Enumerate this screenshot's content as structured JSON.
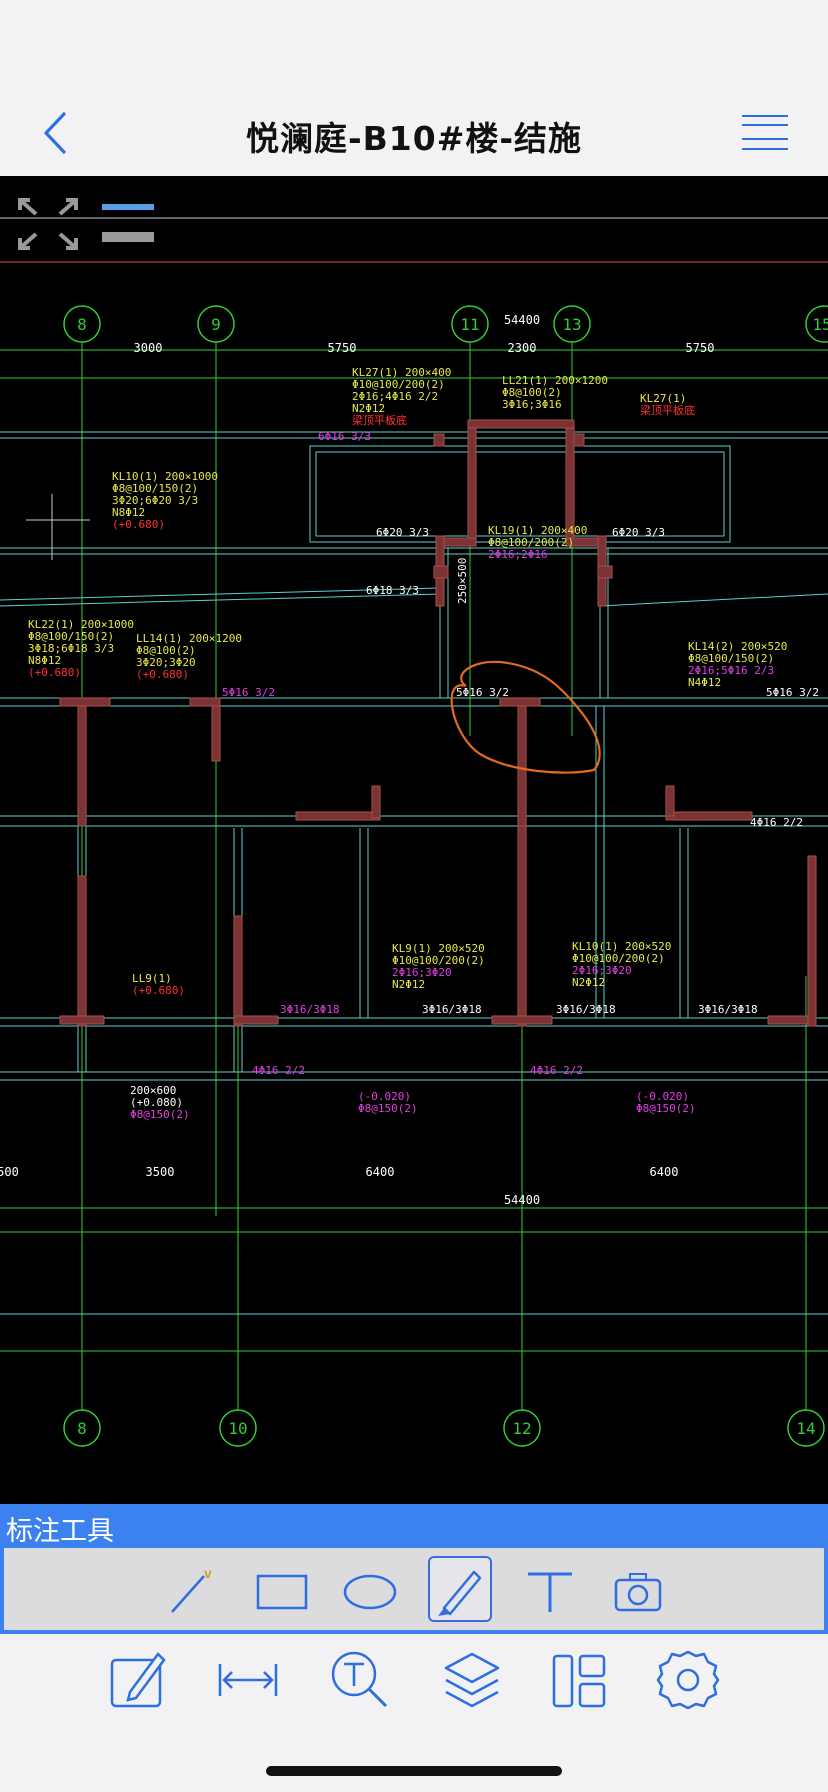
{
  "nav": {
    "title": "悦澜庭-B10#楼-结施",
    "back_icon": "chevron-left-icon",
    "menu_icon": "menu-icon"
  },
  "drawing": {
    "top_axes": [
      "8",
      "9",
      "11",
      "13",
      "15"
    ],
    "bottom_axes": [
      "8",
      "10",
      "12",
      "14"
    ],
    "top_total": "54400",
    "top_spans": [
      "3000",
      "5750",
      "2300",
      "5750"
    ],
    "bottom_total": "54400",
    "bottom_spans": [
      "500",
      "3500",
      "6400",
      "6400"
    ],
    "beam_notes": [
      "KL27(1) 200×400",
      "Φ10@100/200(2)",
      "2Φ16;4Φ16 2/2",
      "N2Φ12",
      "梁顶平板底",
      "LL21(1) 200×1200",
      "Φ8@100(2)",
      "3Φ16;3Φ16",
      "KL27(1)",
      "梁顶平板底",
      "KL10(1) 200×1000",
      "Φ8@100/150(2)",
      "3Φ20;6Φ20 3/3",
      "N8Φ12",
      "(+0.680)",
      "KL22(1) 200×1000",
      "Φ8@100/150(2)",
      "3Φ18;6Φ18 3/3",
      "N8Φ12",
      "(+0.680)",
      "LL14(1) 200×1200",
      "Φ8@100(2)",
      "3Φ20;3Φ20",
      "(+0.680)",
      "KL19(1) 200×400",
      "Φ8@100/200(2)",
      "2Φ16;2Φ16",
      "KL14(2) 200×520",
      "Φ8@100/150(2)",
      "2Φ16;5Φ16 2/3",
      "N4Φ12",
      "KL9(1) 200×520",
      "Φ10@100/200(2)",
      "2Φ16;3Φ20",
      "N2Φ12",
      "KL10(1) 200×520",
      "Φ10@100/200(2)",
      "2Φ16;3Φ20",
      "N2Φ12",
      "LL9(1)",
      "(+0.680)",
      "200×600",
      "(+0.080)",
      "Φ8@150(2)",
      "(-0.020)",
      "Φ8@150(2)",
      "(-0.020)",
      "Φ8@150(2)"
    ],
    "rebar_labels": [
      "6Φ16 3/3",
      "6Φ20 3/3",
      "6Φ20 3/3",
      "6Φ18 3/3",
      "5Φ16 3/2",
      "5Φ16 3/2",
      "5Φ16 3/2",
      "4Φ16 2/2",
      "3Φ16/3Φ18",
      "3Φ16/3Φ18",
      "3Φ16/3Φ18",
      "3Φ16/3Φ18",
      "4Φ16 2/2",
      "4Φ16 2/2",
      "250×500"
    ],
    "colors": {
      "axis": "#33cc33",
      "wall": "#9a3b3b",
      "beam": "#5cd0d0",
      "note_yellow": "#e8e84a",
      "note_magenta": "#e040e0",
      "note_red": "#ff3030",
      "markup": "#e06a20"
    }
  },
  "annotation_tools": {
    "title": "标注工具",
    "items": [
      {
        "icon": "line-icon"
      },
      {
        "icon": "rectangle-icon"
      },
      {
        "icon": "ellipse-icon"
      },
      {
        "icon": "pen-icon",
        "selected": true
      },
      {
        "icon": "text-icon"
      },
      {
        "icon": "camera-icon"
      }
    ]
  },
  "bottom_toolbar": {
    "items": [
      {
        "icon": "edit-icon"
      },
      {
        "icon": "measure-icon"
      },
      {
        "icon": "text-search-icon"
      },
      {
        "icon": "layers-icon"
      },
      {
        "icon": "layout-icon"
      },
      {
        "icon": "settings-icon"
      }
    ]
  }
}
